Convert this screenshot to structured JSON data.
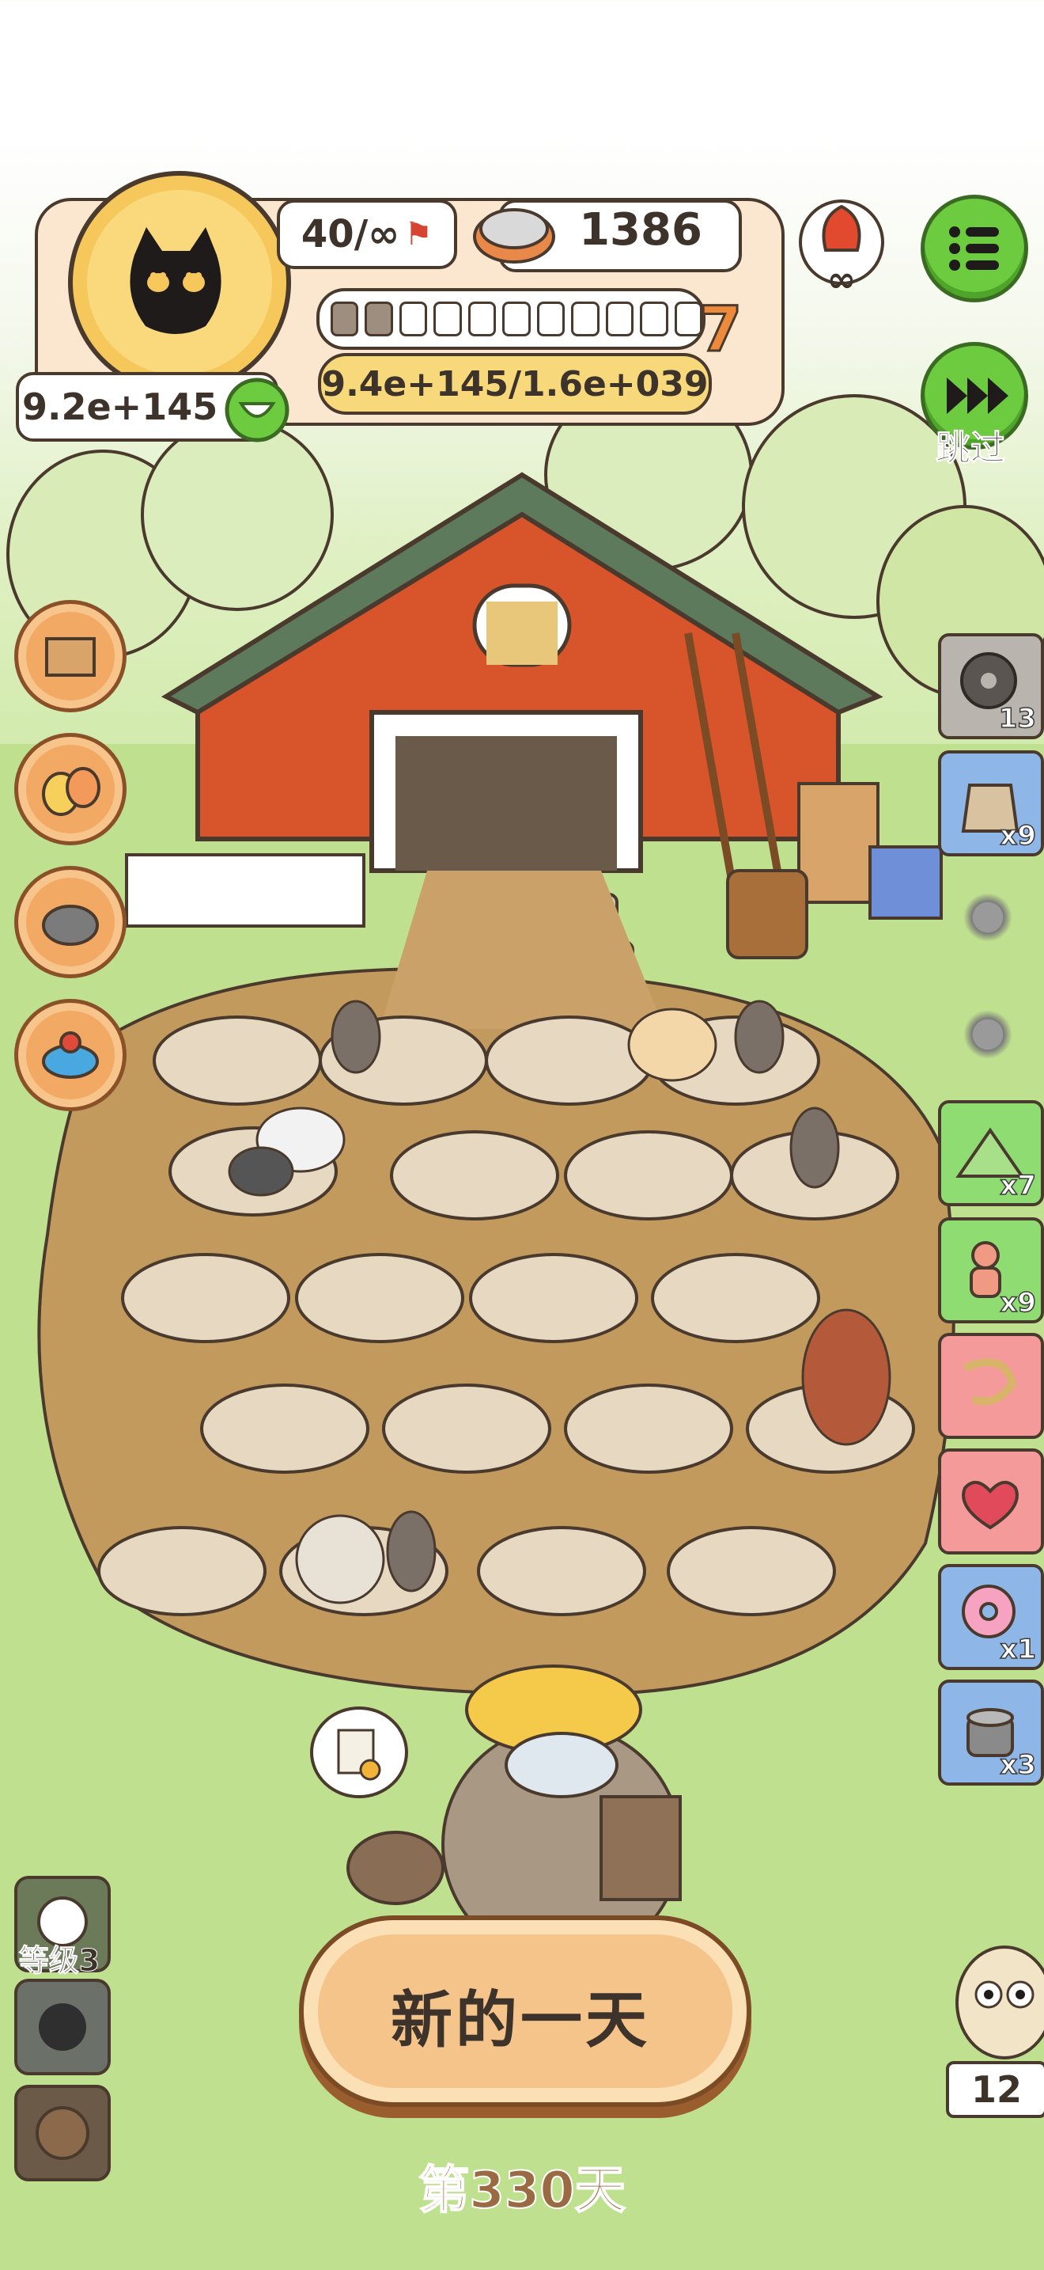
{
  "hud": {
    "level": "40/∞",
    "coins": "1386",
    "score": "9.2e+145",
    "progress": "9.4e+145/1.6e+039",
    "stage_number": "7",
    "stage_segments_filled": 2,
    "stage_segments_total": 11
  },
  "controls": {
    "skip_label": "跳过",
    "level_label": "等级3"
  },
  "items": [
    {
      "icon": "film-reel-icon",
      "count": "13"
    },
    {
      "icon": "grain-sack-icon",
      "count": "x9"
    },
    {
      "icon": "tent-icon",
      "count": "x7"
    },
    {
      "icon": "worker-figure-icon",
      "count": "x9"
    },
    {
      "icon": "rope-tool-icon",
      "count": ""
    },
    {
      "icon": "heart-animal-icon",
      "count": ""
    },
    {
      "icon": "donut-icon",
      "count": "x1"
    },
    {
      "icon": "food-can-icon",
      "count": "x3"
    }
  ],
  "bottom": {
    "new_day_button": "新的一天",
    "day_label": "第330天",
    "owl_count": "12"
  },
  "colors": {
    "hud_panel": "#fbe7cf",
    "accent_green": "#6ccb3f",
    "accent_orange": "#ee8a3b",
    "barn_red": "#d8542a",
    "soil": "#c39a5e"
  }
}
